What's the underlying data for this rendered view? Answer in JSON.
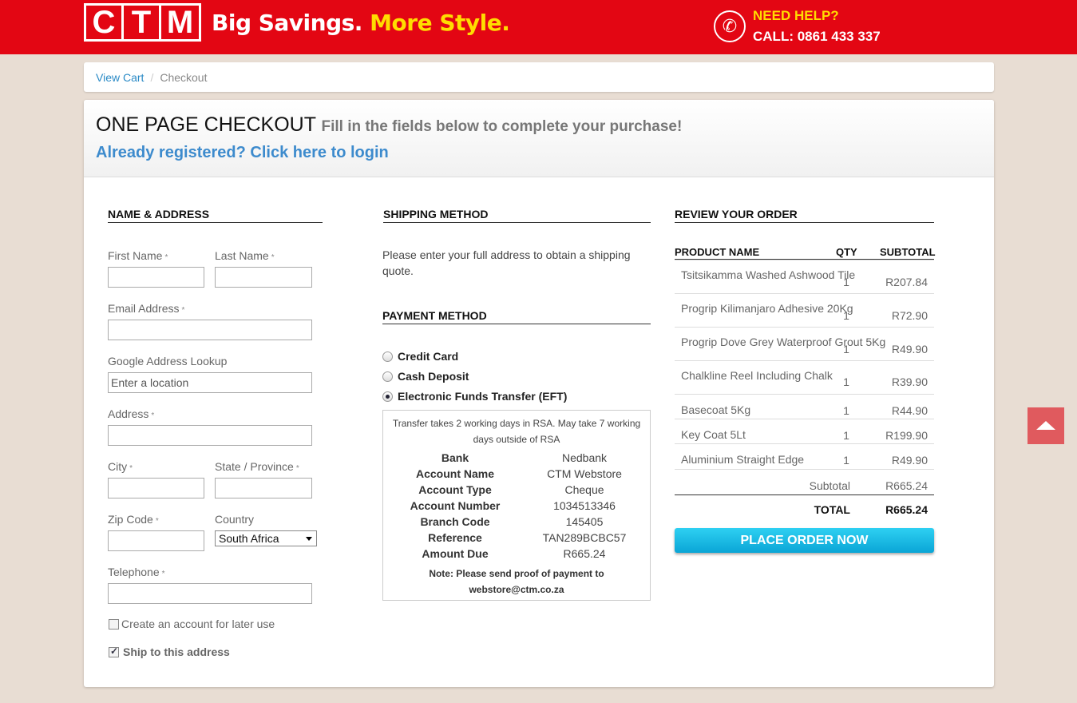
{
  "header": {
    "logo_letters": [
      "C",
      "T",
      "M"
    ],
    "tagline_a": "Big Savings.",
    "tagline_b": "More Style.",
    "help_label": "NEED HELP?",
    "call_label": "CALL: 0861 433 337",
    "colors": {
      "bar": "#e30613",
      "accent": "#ffdd00"
    }
  },
  "breadcrumb": {
    "cart": "View Cart",
    "sep": "/",
    "current": "Checkout"
  },
  "page": {
    "title": "ONE PAGE CHECKOUT",
    "subtitle": "Fill in the fields below to complete your purchase!",
    "login_link": "Already registered? Click here to login"
  },
  "address": {
    "section_title": "NAME & ADDRESS",
    "required_mark": "*",
    "first_name": "First Name",
    "last_name": "Last Name",
    "email": "Email Address",
    "google_lookup": "Google Address Lookup",
    "google_placeholder": "Enter a location",
    "address": "Address",
    "city": "City",
    "state": "State / Province",
    "zip": "Zip Code",
    "country": "Country",
    "country_value": "South Africa",
    "telephone": "Telephone",
    "create_account": "Create an account for later use",
    "ship_here": "Ship to this address"
  },
  "shipping": {
    "section_title": "SHIPPING METHOD",
    "text": "Please enter your full address to obtain a shipping quote."
  },
  "payment": {
    "section_title": "PAYMENT METHOD",
    "options": [
      "Credit Card",
      "Cash Deposit",
      "Electronic Funds Transfer (EFT)"
    ],
    "selected_index": 2,
    "eft_intro": "Transfer takes 2 working days in RSA. May take 7 working days outside of RSA",
    "eft_rows": [
      {
        "k": "Bank",
        "v": "Nedbank"
      },
      {
        "k": "Account Name",
        "v": "CTM Webstore"
      },
      {
        "k": "Account Type",
        "v": "Cheque"
      },
      {
        "k": "Account Number",
        "v": "1034513346"
      },
      {
        "k": "Branch Code",
        "v": "145405"
      },
      {
        "k": "Reference",
        "v": "TAN289BCBC57"
      },
      {
        "k": "Amount Due",
        "v": "R665.24"
      }
    ],
    "eft_note": "Note: Please send proof of payment to webstore@ctm.co.za"
  },
  "order": {
    "section_title": "REVIEW YOUR ORDER",
    "col_product": "PRODUCT NAME",
    "col_qty": "QTY",
    "col_subtotal": "SUBTOTAL",
    "items": [
      {
        "name": "Tsitsikamma Washed Ashwood Tile",
        "qty": "1",
        "subtotal": "R207.84"
      },
      {
        "name": "Progrip Kilimanjaro Adhesive 20Kg",
        "qty": "1",
        "subtotal": "R72.90"
      },
      {
        "name": "Progrip Dove Grey Waterproof Grout 5Kg",
        "qty": "1",
        "subtotal": "R49.90"
      },
      {
        "name": "Chalkline Reel Including Chalk",
        "qty": "1",
        "subtotal": "R39.90"
      },
      {
        "name": "Basecoat 5Kg",
        "qty": "1",
        "subtotal": "R44.90"
      },
      {
        "name": "Key Coat 5Lt",
        "qty": "1",
        "subtotal": "R199.90"
      },
      {
        "name": "Aluminium Straight Edge",
        "qty": "1",
        "subtotal": "R49.90"
      }
    ],
    "subtotal_label": "Subtotal",
    "subtotal_value": "R665.24",
    "total_label": "TOTAL",
    "total_value": "R665.24",
    "place_order": "PLACE ORDER NOW"
  }
}
